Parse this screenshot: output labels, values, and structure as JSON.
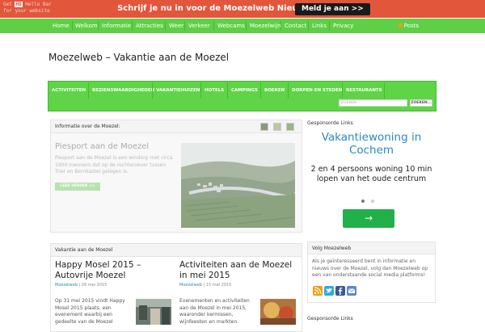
{
  "hellobar": {
    "corner_line1_pre": "Get ",
    "corner_badge": "HB",
    "corner_line1_post": " Hello Bar",
    "corner_line2": "for your website",
    "message": "Schrijf je nu in voor de Moezelweb Nieuwsbrief!",
    "button": "Meld je aan >>",
    "bg_color": "#e2563b"
  },
  "topnav": {
    "items": [
      "Home",
      "Welkom",
      "Informatie",
      "Attracties",
      "Weer",
      "Verkeer",
      "Webcams",
      "Moezelwijn",
      "Contact",
      "Links",
      "Privacy"
    ],
    "posts": "Posts",
    "bg_color": "#5fcf46"
  },
  "site_title": "Moezelweb – Vakantie aan de Moezel",
  "catnav": {
    "items": [
      "Activiteiten",
      "Bezienswaardigheden",
      "Vakantiehuizen",
      "Hotels",
      "Campings",
      "Boeken",
      "Dorpen en steden",
      "Restaurants"
    ],
    "search_placeholder": "ZOEKEN...",
    "search_button": "ZOEKEN..."
  },
  "featured": {
    "header": "Informatie over de Moezel:",
    "title": "Piesport aan de Moezel",
    "description": "Piesport aan de Moezel is een windorp met circa 1900 inwoners dat op de rechteroever tussen Trier en Bernkastel gelegen is.",
    "button": "LEES VERDER >>"
  },
  "sidebar": {
    "sponsored_label": "Gesponsorde Links",
    "ad": {
      "title": "Vakantiewoning in Cochem",
      "body": "2 en 4 persoons woning 10 min lopen van het oude centrum",
      "arrow": "→"
    },
    "follow": {
      "header": "Volg Moezelweb",
      "text": "Als je geïnteresseerd bent in informatie en nieuws over de Moezel, volg dan Moezelweb op een van onderstaande social media platforms!",
      "icons": [
        "rss-icon",
        "twitter-icon",
        "facebook-icon",
        "email-icon"
      ]
    },
    "sponsored_label_2": "Gesponsorde Links"
  },
  "news": {
    "header": "Vakantie aan de Moezel",
    "posts": [
      {
        "title": "Happy Mosel 2015 – Autovrije Moezel",
        "author": "Moezelweb",
        "date": "26 mei 2015",
        "excerpt": "Op 31 mei 2015 vindt Happy Mosel 2015 plaats, een evenement waarbij een gedeelte van de Moezel"
      },
      {
        "title": "Activiteiten aan de Moezel in mei 2015",
        "author": "Moezelweb",
        "date": "15 mei 2015",
        "excerpt": "Evenementen en activiteiten aan de Moezel in mei 2015, waaronder kermissen, wijnfeesten en markten."
      }
    ]
  }
}
